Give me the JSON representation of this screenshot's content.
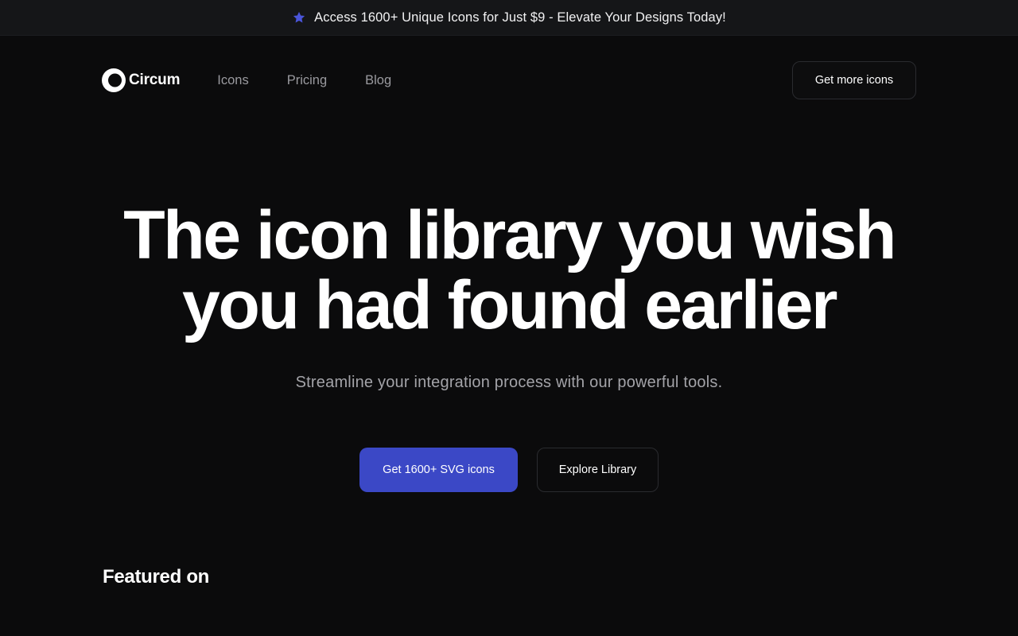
{
  "announcement": {
    "icon": "star-icon",
    "text": "Access 1600+ Unique Icons for Just $9 - Elevate Your Designs Today!"
  },
  "nav": {
    "logo_icon": "circle-logo-icon",
    "logo_text": "Circum",
    "links": [
      "Icons",
      "Pricing",
      "Blog"
    ],
    "cta_label": "Get more icons"
  },
  "hero": {
    "title_line1": "The icon library you wish",
    "title_line2": "you had found earlier",
    "subtitle": "Streamline your integration process with our powerful tools.",
    "primary_button": "Get 1600+ SVG icons",
    "secondary_button": "Explore Library"
  },
  "featured": {
    "heading": "Featured on"
  },
  "colors": {
    "background": "#0b0b0c",
    "announcement_bg": "#151618",
    "accent": "#3b48c6",
    "muted_text": "#9a9a9f"
  }
}
